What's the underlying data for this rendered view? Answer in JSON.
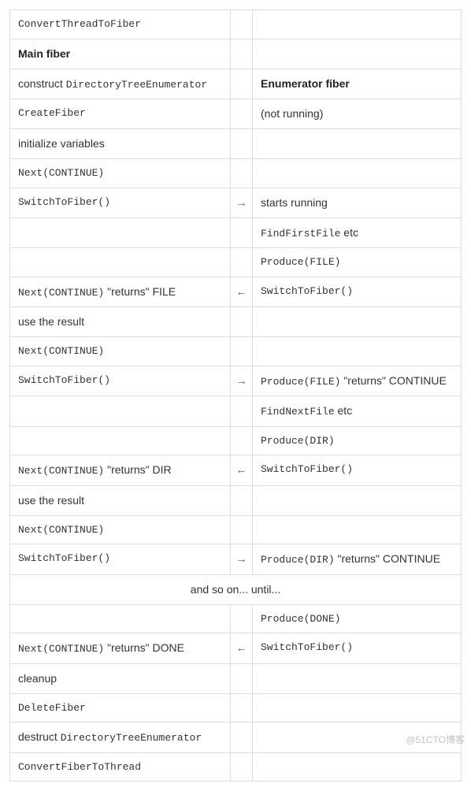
{
  "watermark": "@51CTO博客",
  "arrows": {
    "right": "→",
    "left": "←"
  },
  "rows": {
    "r0_left": "ConvertThreadToFiber",
    "r1_left": "Main fiber",
    "r2_left_pre": "construct ",
    "r2_left_code": "DirectoryTreeEnumerator",
    "r2_right": "Enumerator fiber",
    "r3_left": "CreateFiber",
    "r3_right": "(not running)",
    "r4_left": "initialize variables",
    "r5_left": "Next(CONTINUE)",
    "r6_left": "SwitchToFiber()",
    "r6_right": "starts running",
    "r7_right_code": "FindFirstFile",
    "r7_right_post": " etc",
    "r8_right": "Produce(FILE)",
    "r9_left_code": "Next(CONTINUE)",
    "r9_left_post": " \"returns\" FILE",
    "r9_right": "SwitchToFiber()",
    "r10_left": "use the result",
    "r11_left": "Next(CONTINUE)",
    "r12_left": "SwitchToFiber()",
    "r12_right_code": "Produce(FILE)",
    "r12_right_post": " \"returns\" CONTINUE",
    "r13_right_code": "FindNextFile",
    "r13_right_post": " etc",
    "r14_right": "Produce(DIR)",
    "r15_left_code": "Next(CONTINUE)",
    "r15_left_post": " \"returns\" DIR",
    "r15_right": "SwitchToFiber()",
    "r16_left": "use the result",
    "r17_left": "Next(CONTINUE)",
    "r18_left": "SwitchToFiber()",
    "r18_right_code": "Produce(DIR)",
    "r18_right_post": " \"returns\" CONTINUE",
    "r19_center": "and so on... until...",
    "r20_right": "Produce(DONE)",
    "r21_left_code": "Next(CONTINUE)",
    "r21_left_post": " \"returns\" DONE",
    "r21_right": "SwitchToFiber()",
    "r22_left": "cleanup",
    "r23_left": "DeleteFiber",
    "r24_left_pre": "destruct ",
    "r24_left_code": "DirectoryTreeEnumerator",
    "r25_left": "ConvertFiberToThread"
  }
}
